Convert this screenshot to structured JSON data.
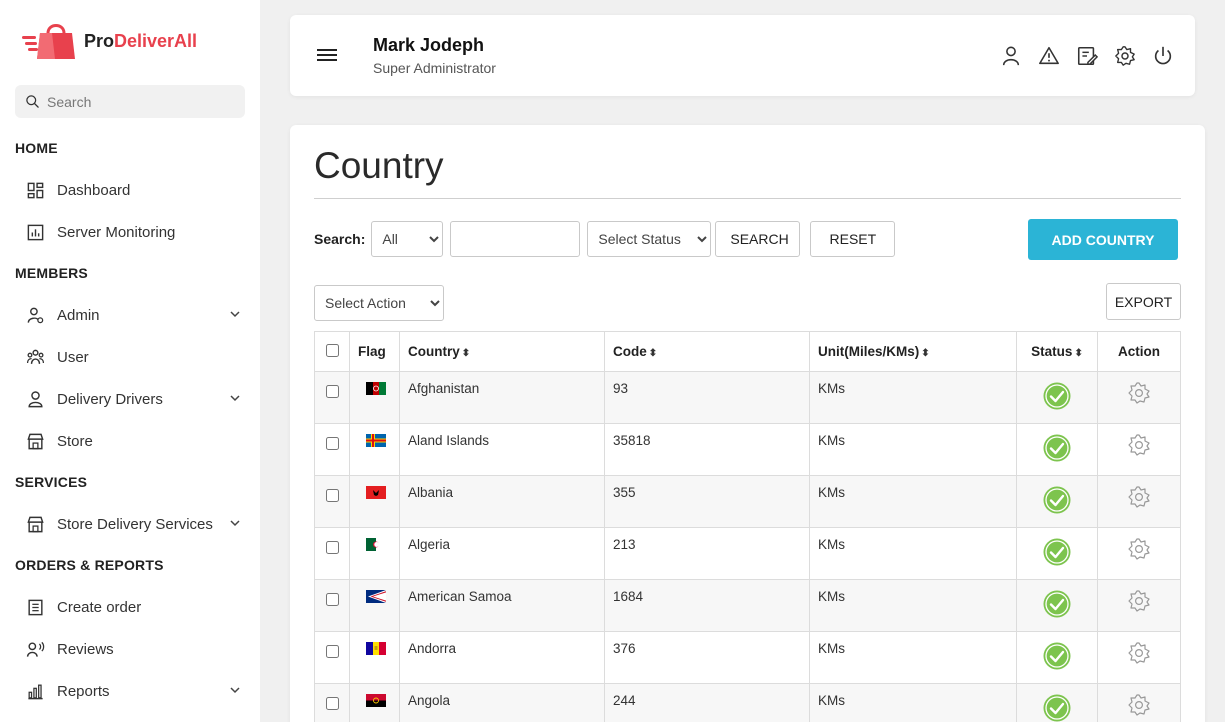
{
  "app": {
    "logo_prefix": "Pro",
    "logo_suffix": "DeliverAll",
    "brand_color": "#e8414d",
    "accent_color": "#2bb4d6",
    "status_color": "#7dc44e"
  },
  "sidebar": {
    "search_placeholder": "Search",
    "sections": {
      "home": "HOME",
      "members": "MEMBERS",
      "services": "SERVICES",
      "orders": "ORDERS & REPORTS"
    },
    "items": {
      "dashboard": "Dashboard",
      "server_monitoring": "Server Monitoring",
      "admin": "Admin",
      "user": "User",
      "delivery_drivers": "Delivery Drivers",
      "store": "Store",
      "store_delivery_services": "Store Delivery Services",
      "create_order": "Create order",
      "reviews": "Reviews",
      "reports": "Reports"
    }
  },
  "header": {
    "user_name": "Mark Jodeph",
    "user_role": "Super Administrator",
    "icons": [
      "user-icon",
      "alert-icon",
      "edit-icon",
      "settings-icon",
      "power-icon"
    ]
  },
  "main": {
    "title": "Country",
    "search_label": "Search:",
    "search_field_selected": "All",
    "search_input_value": "",
    "status_select": "Select Status",
    "search_button": "SEARCH",
    "reset_button": "RESET",
    "add_button": "ADD COUNTRY",
    "action_select": "Select Action",
    "export_button": "EXPORT",
    "columns": {
      "flag": "Flag",
      "country": "Country",
      "code": "Code",
      "unit": "Unit(Miles/KMs)",
      "status": "Status",
      "action": "Action"
    },
    "sort_glyph": "⬍",
    "rows": [
      {
        "country": "Afghanistan",
        "code": "93",
        "unit": "KMs",
        "flag": "afghanistan"
      },
      {
        "country": "Aland Islands",
        "code": "35818",
        "unit": "KMs",
        "flag": "aland"
      },
      {
        "country": "Albania",
        "code": "355",
        "unit": "KMs",
        "flag": "albania"
      },
      {
        "country": "Algeria",
        "code": "213",
        "unit": "KMs",
        "flag": "algeria"
      },
      {
        "country": "American Samoa",
        "code": "1684",
        "unit": "KMs",
        "flag": "american-samoa"
      },
      {
        "country": "Andorra",
        "code": "376",
        "unit": "KMs",
        "flag": "andorra"
      },
      {
        "country": "Angola",
        "code": "244",
        "unit": "KMs",
        "flag": "angola"
      }
    ]
  }
}
